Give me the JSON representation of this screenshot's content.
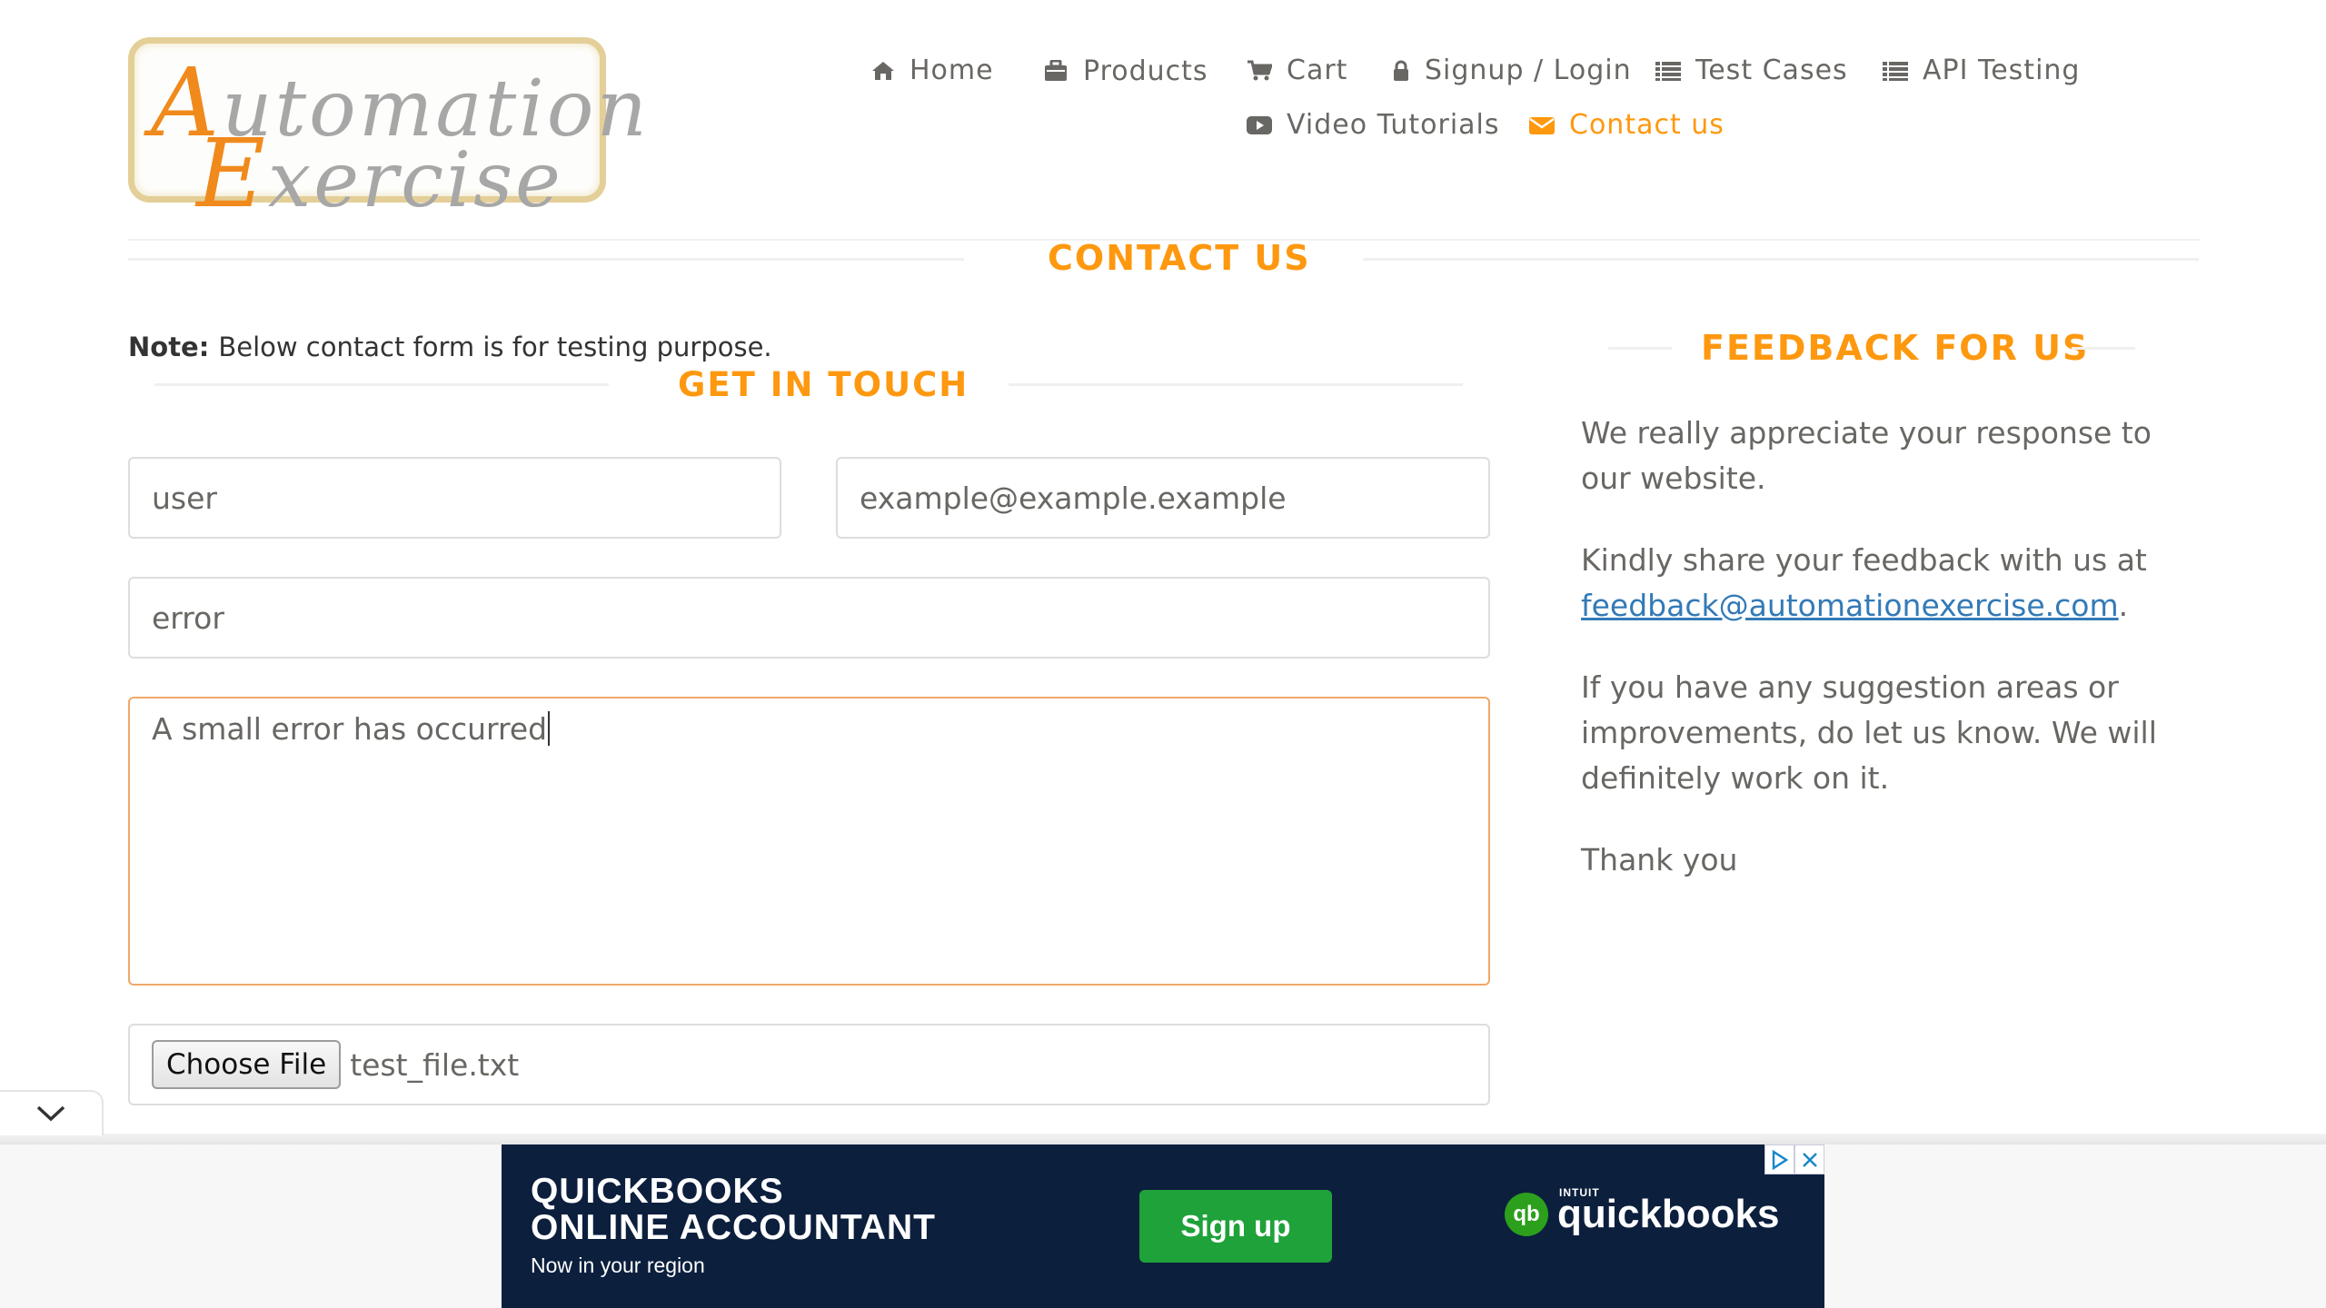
{
  "logo": {
    "line1_cap": "A",
    "line1_rest": "utomation",
    "line2_cap": "E",
    "line2_rest": "xercise"
  },
  "nav": [
    {
      "label": "Home",
      "icon": "home-icon"
    },
    {
      "label": "Products",
      "icon": "briefcase-icon"
    },
    {
      "label": "Cart",
      "icon": "cart-icon"
    },
    {
      "label": "Signup / Login",
      "icon": "lock-icon"
    },
    {
      "label": "Test Cases",
      "icon": "list-icon"
    },
    {
      "label": "API Testing",
      "icon": "list-icon"
    },
    {
      "label": "Video Tutorials",
      "icon": "youtube-icon"
    },
    {
      "label": "Contact us",
      "icon": "envelope-icon",
      "active": true
    }
  ],
  "page_title": "CONTACT US",
  "note": {
    "label": "Note:",
    "text": "Below contact form is for testing purpose."
  },
  "form": {
    "title": "GET IN TOUCH",
    "name_value": "user",
    "email_value": "example@example.example",
    "subject_value": "error",
    "message_value": "A small error has occurred",
    "file_button": "Choose File",
    "file_name": "test_file.txt"
  },
  "feedback": {
    "title": "FEEDBACK FOR US",
    "p1": "We really appreciate your response to our website.",
    "p2_prefix": "Kindly share your feedback with us at",
    "p2_email": "feedback@automationexercise.com",
    "p2_suffix": ".",
    "p3": "If you have any suggestion areas or improvements, do let us know. We will definitely work on it.",
    "p4": "Thank you"
  },
  "ad": {
    "headline_line1": "QUICKBOOKS",
    "headline_line2": "ONLINE ACCOUNTANT",
    "subline": "Now in your region",
    "cta": "Sign up",
    "brand_logo_mark": "qb",
    "brand_small": "INTUIT",
    "brand": "quickbooks"
  },
  "colors": {
    "accent": "#FE980F",
    "text": "#696763",
    "link": "#337AB7",
    "ad_bg": "#0C1F3D",
    "ad_button": "#1FA23A"
  }
}
